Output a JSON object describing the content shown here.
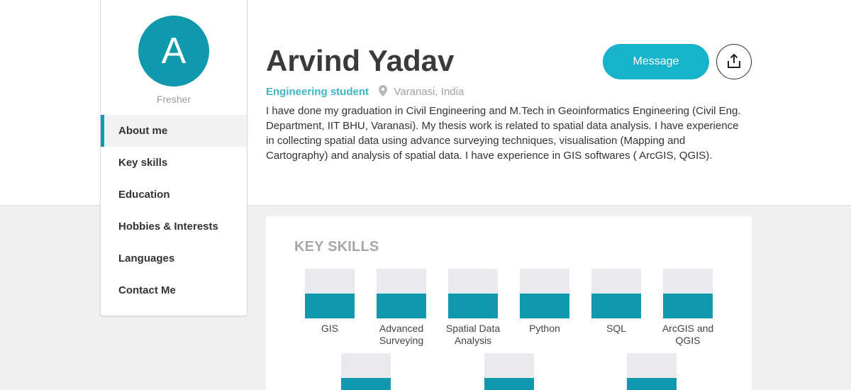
{
  "sidebar": {
    "avatar_letter": "A",
    "level": "Fresher",
    "nav": [
      {
        "label": "About me",
        "active": true
      },
      {
        "label": "Key skills"
      },
      {
        "label": "Education"
      },
      {
        "label": "Hobbies & Interests"
      },
      {
        "label": "Languages"
      },
      {
        "label": "Contact Me"
      }
    ]
  },
  "profile": {
    "name": "Arvind Yadav",
    "role": "Engineering student",
    "location": "Varanasi, India",
    "bio": "I have done my graduation in Civil Engineering and M.Tech in Geoinformatics Engineering (Civil Eng. Department, IIT BHU, Varanasi). My thesis work is related to spatial data analysis. I have experience in collecting spatial data using advance surveying techniques, visualisation (Mapping and Cartography) and analysis of spatial data. I have experience in GIS softwares ( ArcGIS, QGIS)."
  },
  "actions": {
    "message_label": "Message",
    "share_icon": "share-icon"
  },
  "skills": {
    "title": "KEY SKILLS",
    "items": [
      {
        "label": "GIS",
        "level": 0.5
      },
      {
        "label": "Advanced Surveying",
        "level": 0.5
      },
      {
        "label": "Spatial Data Analysis",
        "level": 0.5
      },
      {
        "label": "Python",
        "level": 0.5
      },
      {
        "label": "SQL",
        "level": 0.5
      },
      {
        "label": "ArcGIS and QGIS",
        "level": 0.5
      },
      {
        "label": "",
        "level": 0.5
      },
      {
        "label": "",
        "level": 0.5
      },
      {
        "label": "",
        "level": 0.5
      }
    ]
  },
  "colors": {
    "accent": "#0e99ac",
    "button": "#16b3cb",
    "role_text": "#3fb5c4"
  }
}
